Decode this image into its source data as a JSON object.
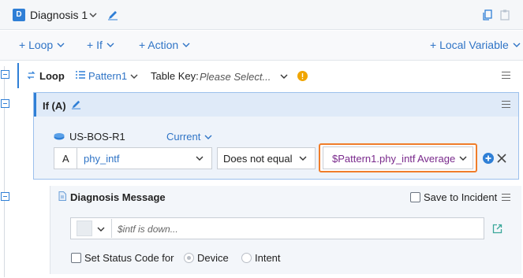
{
  "header": {
    "badge": "D",
    "title": "Diagnosis 1"
  },
  "toolbar": {
    "loop_label": "+ Loop",
    "if_label": "+ If",
    "action_label": "+ Action",
    "local_variable_label": "+ Local Variable"
  },
  "loop": {
    "label": "Loop",
    "pattern": "Pattern1",
    "table_key_label": "Table Key:",
    "table_key_placeholder": "Please Select..."
  },
  "if_block": {
    "label": "If (A)",
    "device": "US-BOS-R1",
    "scope": "Current",
    "row_letter": "A",
    "field": "phy_intf",
    "operator": "Does not equal",
    "value_variable": "$Pattern1.phy_intf",
    "value_modifier": "Average"
  },
  "diagnosis": {
    "title": "Diagnosis Message",
    "save_to_incident": "Save to Incident",
    "message_placeholder": "$intf is down...",
    "set_status_code": "Set Status Code for",
    "device_option": "Device",
    "intent_option": "Intent"
  },
  "colors": {
    "accent": "#2f7fd6",
    "highlight_border": "#f07d2a",
    "warning": "#f0a500",
    "value_text": "#7a2a8c"
  }
}
